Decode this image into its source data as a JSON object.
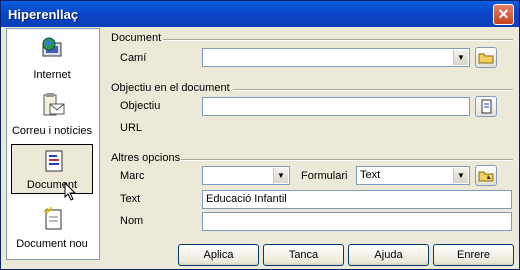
{
  "window": {
    "title": "Hiperenllaç",
    "close_glyph": "✕"
  },
  "sidebar": {
    "items": [
      {
        "label": "Internet",
        "icon": "globe-icon"
      },
      {
        "label": "Correu i notícies",
        "icon": "mail-icon"
      },
      {
        "label": "Document",
        "icon": "document-icon",
        "active": true
      },
      {
        "label": "Document nou",
        "icon": "new-document-icon"
      }
    ]
  },
  "document_section": {
    "title": "Document",
    "path_label": "Camí",
    "path_value": ""
  },
  "target_section": {
    "title": "Objectiu en el document",
    "target_label": "Objectiu",
    "target_value": "",
    "url_label": "URL"
  },
  "other_section": {
    "title": "Altres opcions",
    "frame_label": "Marc",
    "frame_value": "",
    "form_label": "Formulari",
    "form_value": "Text",
    "text_label": "Text",
    "text_value": "Educació Infantil",
    "name_label": "Nom",
    "name_value": ""
  },
  "buttons": {
    "apply": "Aplica",
    "close": "Tanca",
    "help": "Ajuda",
    "back": "Enrere"
  }
}
